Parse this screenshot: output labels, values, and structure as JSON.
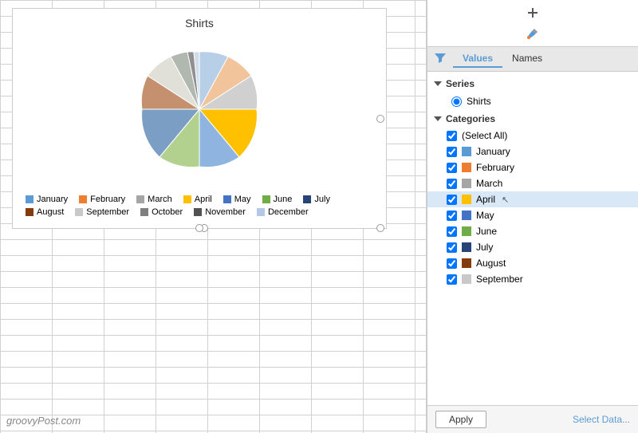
{
  "chart": {
    "title": "Shirts",
    "months": [
      {
        "name": "January",
        "color": "#5b9bd5",
        "value": 8,
        "startAngle": 0
      },
      {
        "name": "February",
        "color": "#ed7d31",
        "value": 8,
        "startAngle": 30
      },
      {
        "name": "March",
        "color": "#a5a5a5",
        "value": 8,
        "startAngle": 60
      },
      {
        "name": "April",
        "color": "#ffc000",
        "value": 14,
        "startAngle": 90
      },
      {
        "name": "May",
        "color": "#4472c4",
        "value": 8,
        "startAngle": 144
      },
      {
        "name": "June",
        "color": "#70ad47",
        "value": 8,
        "startAngle": 174
      },
      {
        "name": "July",
        "color": "#264478",
        "value": 8,
        "startAngle": 204
      },
      {
        "name": "August",
        "color": "#843c0c",
        "value": 8,
        "startAngle": 234
      },
      {
        "name": "September",
        "color": "#c9c9c9",
        "value": 8,
        "startAngle": 264
      },
      {
        "name": "October",
        "color": "#7f7f7f",
        "value": 8,
        "startAngle": 294
      },
      {
        "name": "November",
        "color": "#525252",
        "value": 8,
        "startAngle": 324
      },
      {
        "name": "December",
        "color": "#b4c7e7",
        "value": 6,
        "startAngle": 354
      }
    ]
  },
  "filter_panel": {
    "tabs": [
      "Values",
      "Names"
    ],
    "active_tab": "Values",
    "sections": {
      "series": {
        "label": "Series",
        "items": [
          "Shirts"
        ]
      },
      "categories": {
        "label": "Categories",
        "items": [
          {
            "label": "(Select All)",
            "checked": true,
            "color": null
          },
          {
            "label": "January",
            "checked": true,
            "color": "#5b9bd5"
          },
          {
            "label": "February",
            "checked": true,
            "color": "#ed7d31"
          },
          {
            "label": "March",
            "checked": true,
            "color": "#a5a5a5"
          },
          {
            "label": "April",
            "checked": true,
            "color": "#ffc000",
            "highlighted": true
          },
          {
            "label": "May",
            "checked": true,
            "color": "#4472c4"
          },
          {
            "label": "June",
            "checked": true,
            "color": "#70ad47"
          },
          {
            "label": "July",
            "checked": true,
            "color": "#264478"
          },
          {
            "label": "August",
            "checked": true,
            "color": "#843c0c"
          },
          {
            "label": "September",
            "checked": true,
            "color": "#c9c9c9"
          }
        ]
      }
    },
    "buttons": {
      "apply": "Apply",
      "select_data": "Select Data..."
    }
  },
  "toolbar": {
    "plus_label": "+",
    "brush_label": "🖌"
  },
  "watermark": "groovyPost.com"
}
